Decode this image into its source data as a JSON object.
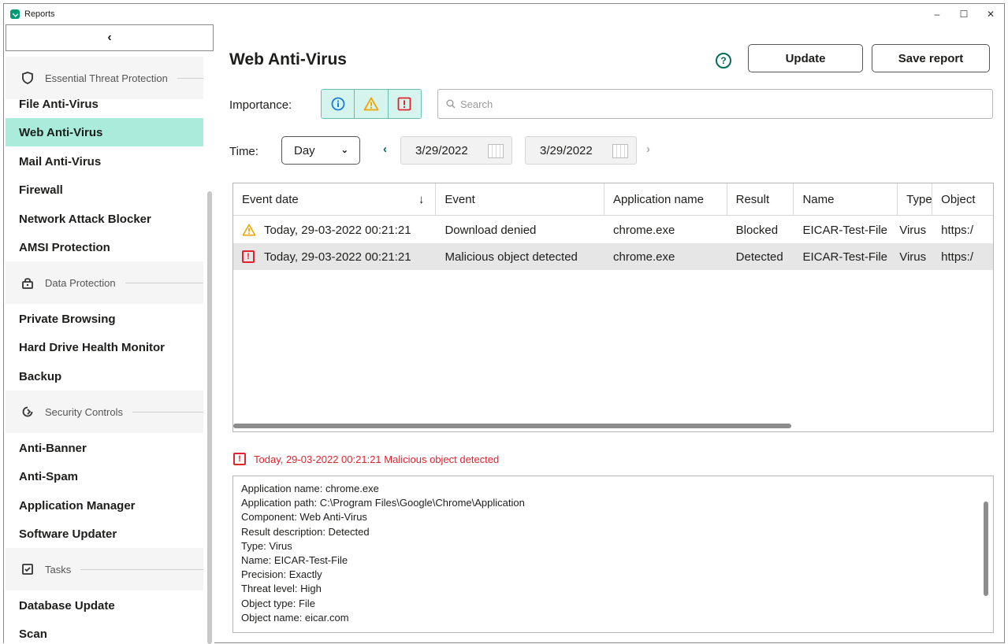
{
  "window": {
    "title": "Reports",
    "minimize": "–",
    "maximize": "☐",
    "close": "✕"
  },
  "sidebar": {
    "collapse": "‹",
    "groups": [
      {
        "label": "Essential Threat Protection",
        "icon": "shield-icon"
      },
      {
        "label": "Data Protection",
        "icon": "lock-icon"
      },
      {
        "label": "Security Controls",
        "icon": "controls-icon"
      },
      {
        "label": "Tasks",
        "icon": "tasks-icon"
      }
    ],
    "items": [
      {
        "label": "File Anti-Virus"
      },
      {
        "label": "Web Anti-Virus",
        "active": true
      },
      {
        "label": "Mail Anti-Virus"
      },
      {
        "label": "Firewall"
      },
      {
        "label": "Network Attack Blocker"
      },
      {
        "label": "AMSI Protection"
      },
      {
        "label": "Private Browsing"
      },
      {
        "label": "Hard Drive Health Monitor"
      },
      {
        "label": "Backup"
      },
      {
        "label": "Anti-Banner"
      },
      {
        "label": "Anti-Spam"
      },
      {
        "label": "Application Manager"
      },
      {
        "label": "Software Updater"
      },
      {
        "label": "Database Update"
      },
      {
        "label": "Scan"
      }
    ]
  },
  "main": {
    "title": "Web Anti-Virus",
    "help": "?",
    "update_label": "Update",
    "save_label": "Save report",
    "importance_label": "Importance:",
    "search_placeholder": "Search",
    "time_label": "Time:",
    "period": "Day",
    "date_from": "3/29/2022",
    "date_to": "3/29/2022"
  },
  "table": {
    "columns": [
      "Event date",
      "Event",
      "Application name",
      "Result",
      "Name",
      "Type",
      "Object"
    ],
    "rows": [
      {
        "severity": "warning",
        "date": "Today, 29-03-2022 00:21:21",
        "event": "Download denied",
        "app": "chrome.exe",
        "result": "Blocked",
        "name": "EICAR-Test-File",
        "type": "Virus",
        "object": "https:/"
      },
      {
        "severity": "critical",
        "date": "Today, 29-03-2022 00:21:21",
        "event": "Malicious object detected",
        "app": "chrome.exe",
        "result": "Detected",
        "name": "EICAR-Test-File",
        "type": "Virus",
        "object": "https:/"
      }
    ]
  },
  "detail": {
    "heading": "Today, 29-03-2022 00:21:21 Malicious object detected",
    "lines": [
      "Application name: chrome.exe",
      "Application path: C:\\Program Files\\Google\\Chrome\\Application",
      "Component: Web Anti-Virus",
      "Result description: Detected",
      "Type: Virus",
      "Name: EICAR-Test-File",
      "Precision: Exactly",
      "Threat level: High",
      "Object type: File",
      "Object name: eicar.com"
    ]
  },
  "colors": {
    "accent": "#a9ecdc",
    "danger": "#e0232f",
    "warning": "#f0a500",
    "info": "#1a7fd6",
    "brand": "#009b76"
  }
}
